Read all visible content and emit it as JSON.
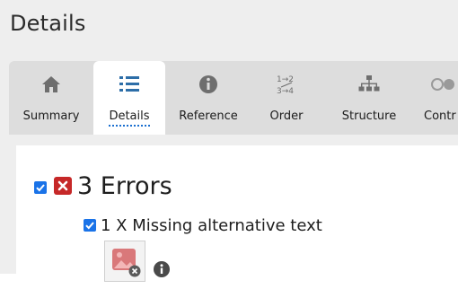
{
  "panel": {
    "title": "Details"
  },
  "tabs": [
    {
      "label": "Summary",
      "icon": "home-icon",
      "active": false
    },
    {
      "label": "Details",
      "icon": "list-icon",
      "active": true
    },
    {
      "label": "Reference",
      "icon": "info-icon",
      "active": false
    },
    {
      "label": "Order",
      "icon": "order-icon",
      "active": false
    },
    {
      "label": "Structure",
      "icon": "structure-icon",
      "active": false
    },
    {
      "label": "Contr",
      "icon": "contrast-icon",
      "active": false
    }
  ],
  "errors": {
    "title": "3 Errors",
    "checked": true,
    "items": [
      {
        "text": "1 X Missing alternative text",
        "checked": true,
        "icon": "image-error-icon",
        "info_icon": "info-icon"
      }
    ]
  },
  "colors": {
    "accent": "#1a73e8",
    "error": "#c62828",
    "icon_gray": "#6e6e6e",
    "tab_bar": "#dddddd",
    "panel_bg": "#eeeeee"
  }
}
